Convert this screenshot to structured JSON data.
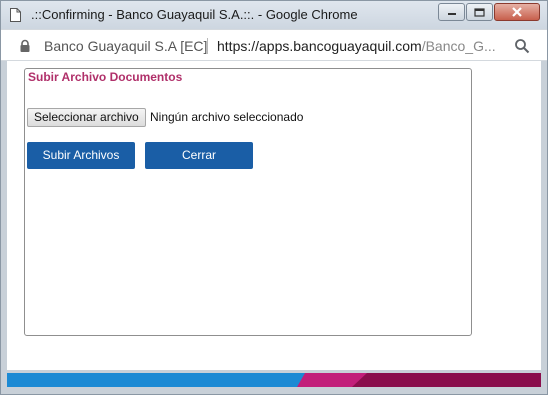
{
  "window": {
    "title": ".::Confirming - Banco Guayaquil S.A.::. - Google Chrome"
  },
  "address_bar": {
    "site_name": "Banco Guayaquil S.A [EC]",
    "url_host": "https://apps.bancoguayaquil.com",
    "url_path": "/Banco_G..."
  },
  "panel": {
    "title": "Subir Archivo Documentos",
    "title_color": "#b0306a"
  },
  "file_input": {
    "button_label": "Seleccionar archivo",
    "status_text": "Ningún archivo seleccionado"
  },
  "buttons": {
    "upload_label": "Subir Archivos",
    "close_label": "Cerrar",
    "color": "#1a5ea6"
  },
  "icons": {
    "page": "page-icon",
    "lock": "lock-icon",
    "zoom": "zoom-icon",
    "minimize": "minimize-icon",
    "maximize": "maximize-icon",
    "close": "close-icon"
  },
  "colors": {
    "band_left": "#1c8ad4",
    "band_middle": "#c21f7a",
    "band_right": "#8a0e4c"
  }
}
